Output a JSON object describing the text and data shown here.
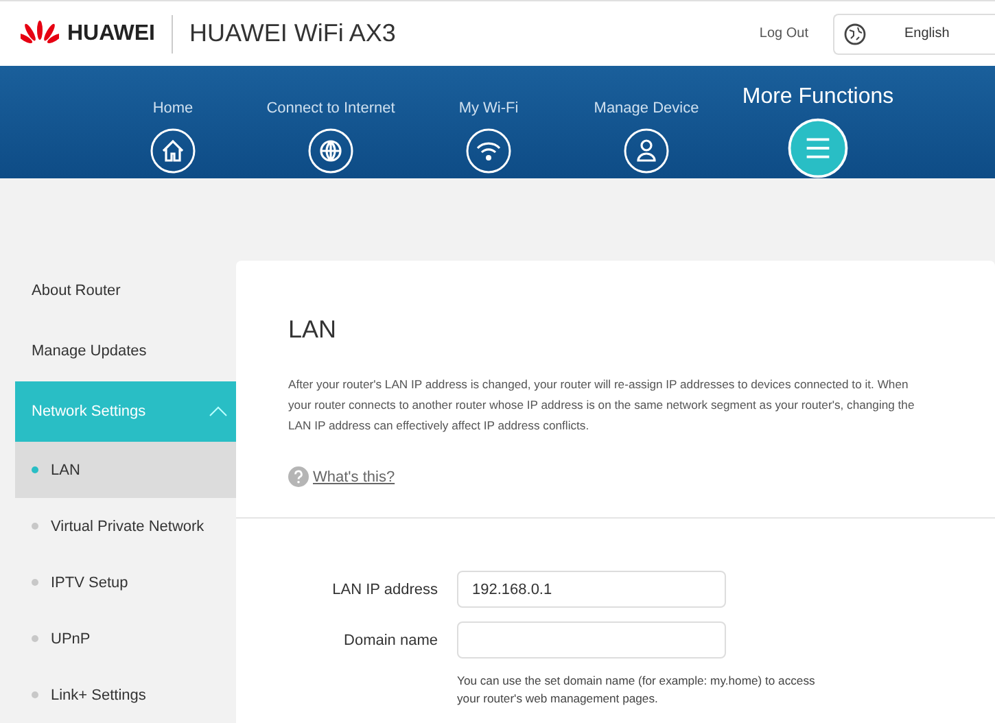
{
  "header": {
    "brand": "HUAWEI",
    "product": "HUAWEI WiFi AX3",
    "logout": "Log Out",
    "language": "English"
  },
  "nav": [
    {
      "label": "Home",
      "kind": "home",
      "selected": false
    },
    {
      "label": "Connect to Internet",
      "kind": "globe",
      "selected": false
    },
    {
      "label": "My Wi-Fi",
      "kind": "wifi",
      "selected": false
    },
    {
      "label": "Manage Device",
      "kind": "user",
      "selected": false
    },
    {
      "label": "More Functions",
      "kind": "menu",
      "selected": true
    }
  ],
  "sidebar": {
    "items": [
      {
        "label": "About Router",
        "selected": false
      },
      {
        "label": "Manage Updates",
        "selected": false
      },
      {
        "label": "Network Settings",
        "selected": true,
        "expanded": true,
        "children": [
          {
            "label": "LAN",
            "selected": true
          },
          {
            "label": "Virtual Private Network",
            "selected": false
          },
          {
            "label": "IPTV Setup",
            "selected": false
          },
          {
            "label": "UPnP",
            "selected": false
          },
          {
            "label": "Link+ Settings",
            "selected": false
          }
        ]
      }
    ]
  },
  "content": {
    "title": "LAN",
    "description": "After your router's LAN IP address is changed, your router will re-assign IP addresses to devices connected to it. When your router connects to another router whose IP address is on the same network segment as your router's, changing the LAN IP address can effectively affect IP address conflicts.",
    "help_link": "What's this?",
    "fields": [
      {
        "label": "LAN IP address",
        "value": "192.168.0.1"
      },
      {
        "label": "Domain name"
      }
    ],
    "hint": "You can use the set domain name (for example: my.home) to access your router's web management pages."
  }
}
